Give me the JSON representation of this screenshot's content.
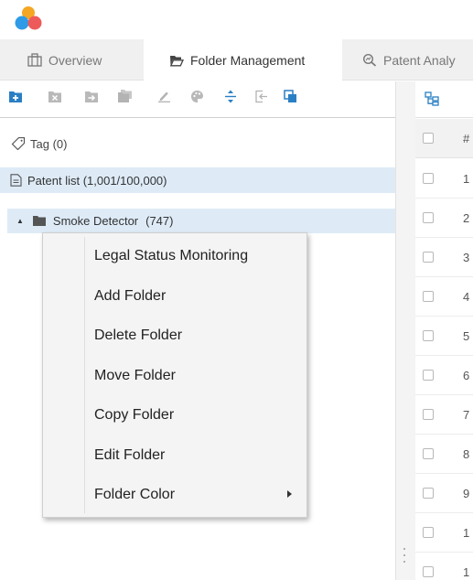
{
  "app": {
    "logo_icon": "app-logo-icon"
  },
  "tabs": [
    {
      "label": "Overview",
      "icon": "briefcase-icon",
      "active": false
    },
    {
      "label": "Folder Management",
      "icon": "folder-open-icon",
      "active": true
    },
    {
      "label": "Patent Analy",
      "icon": "analysis-icon",
      "active": false
    }
  ],
  "toolbar": {
    "icons": [
      "add-folder-icon",
      "delete-folder-icon",
      "move-folder-icon",
      "copy-folder-icon",
      "edit-icon",
      "palette-icon",
      "expand-collapse-icon",
      "export-icon",
      "copy-icon"
    ]
  },
  "tree": {
    "tag_label": "Tag (0)",
    "patent_list_label": "Patent list (1,001/100,000)",
    "folder": {
      "name": "Smoke Detector",
      "count": "(747)"
    }
  },
  "context_menu": {
    "items": [
      {
        "label": "Legal Status Monitoring",
        "submenu": false
      },
      {
        "label": "Add Folder",
        "submenu": false
      },
      {
        "label": "Delete Folder",
        "submenu": false
      },
      {
        "label": "Move Folder",
        "submenu": false
      },
      {
        "label": "Copy Folder",
        "submenu": false
      },
      {
        "label": "Edit Folder",
        "submenu": false
      },
      {
        "label": "Folder Color",
        "submenu": true
      }
    ]
  },
  "table": {
    "header_label": "#",
    "rows": [
      "1",
      "2",
      "3",
      "4",
      "5",
      "6",
      "7",
      "8",
      "9",
      "1",
      "1"
    ]
  },
  "colors": {
    "accent": "#2a7fc4",
    "selection": "#deebf7",
    "tab_bar": "#f0f0f0",
    "menu_bg": "#f4f4f4"
  }
}
